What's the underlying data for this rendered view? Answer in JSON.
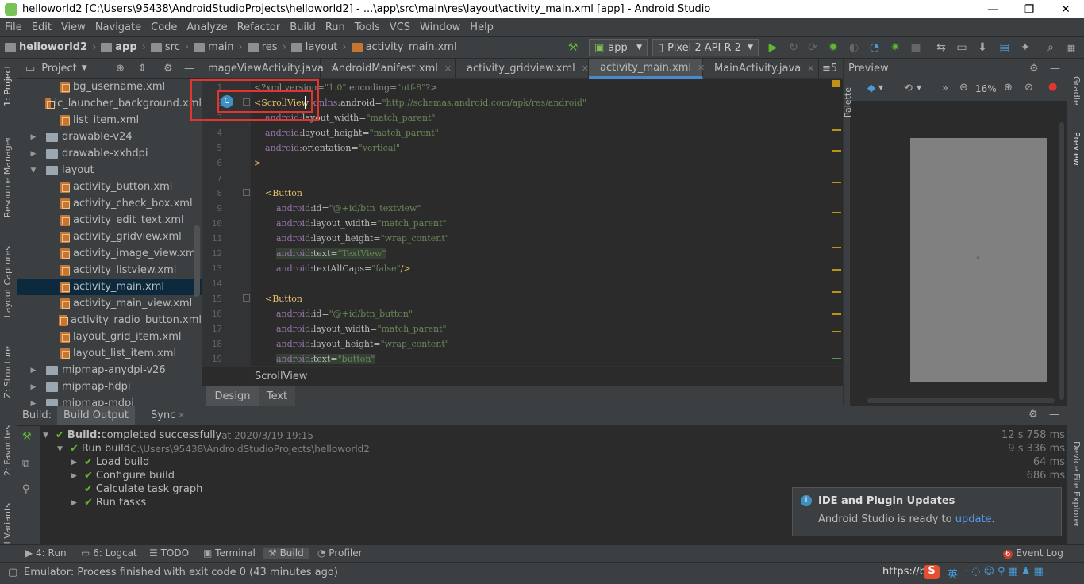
{
  "window": {
    "title": "helloworld2 [C:\\Users\\95438\\AndroidStudioProjects\\helloworld2] - ...\\app\\src\\main\\res\\layout\\activity_main.xml [app] - Android Studio",
    "min": "—",
    "max": "❐",
    "close": "✕"
  },
  "menu": [
    "File",
    "Edit",
    "View",
    "Navigate",
    "Code",
    "Analyze",
    "Refactor",
    "Build",
    "Run",
    "Tools",
    "VCS",
    "Window",
    "Help"
  ],
  "breadcrumbs": [
    "helloworld2",
    "app",
    "src",
    "main",
    "res",
    "layout",
    "activity_main.xml"
  ],
  "toolbar": {
    "config": "app",
    "device": "Pixel 2 API R 2"
  },
  "project": {
    "header": "Project",
    "items": [
      {
        "label": "bg_username.xml",
        "kind": "xml",
        "indent": 2
      },
      {
        "label": "ic_launcher_background.xml",
        "kind": "xml",
        "indent": 2
      },
      {
        "label": "list_item.xml",
        "kind": "xml",
        "indent": 2
      },
      {
        "label": "drawable-v24",
        "kind": "folder",
        "indent": 1,
        "arrow": "▶"
      },
      {
        "label": "drawable-xxhdpi",
        "kind": "folder",
        "indent": 1,
        "arrow": "▶"
      },
      {
        "label": "layout",
        "kind": "folder",
        "indent": 1,
        "arrow": "▼"
      },
      {
        "label": "activity_button.xml",
        "kind": "xml",
        "indent": 2
      },
      {
        "label": "activity_check_box.xml",
        "kind": "xml",
        "indent": 2
      },
      {
        "label": "activity_edit_text.xml",
        "kind": "xml",
        "indent": 2
      },
      {
        "label": "activity_gridview.xml",
        "kind": "xml",
        "indent": 2
      },
      {
        "label": "activity_image_view.xml",
        "kind": "xml",
        "indent": 2
      },
      {
        "label": "activity_listview.xml",
        "kind": "xml",
        "indent": 2
      },
      {
        "label": "activity_main.xml",
        "kind": "xml",
        "indent": 2,
        "selected": true
      },
      {
        "label": "activity_main_view.xml",
        "kind": "xml",
        "indent": 2
      },
      {
        "label": "activity_radio_button.xml",
        "kind": "xml",
        "indent": 2
      },
      {
        "label": "layout_grid_item.xml",
        "kind": "xml",
        "indent": 2
      },
      {
        "label": "layout_list_item.xml",
        "kind": "xml",
        "indent": 2
      },
      {
        "label": "mipmap-anydpi-v26",
        "kind": "folder",
        "indent": 1,
        "arrow": "▶"
      },
      {
        "label": "mipmap-hdpi",
        "kind": "folder",
        "indent": 1,
        "arrow": "▶"
      },
      {
        "label": "mipmap-mdpi",
        "kind": "folder",
        "indent": 1,
        "arrow": "▶"
      }
    ]
  },
  "tabs": [
    {
      "label": "mageViewActivity.java",
      "type": "java"
    },
    {
      "label": "AndroidManifest.xml",
      "type": "manifest"
    },
    {
      "label": "activity_gridview.xml",
      "type": "xml"
    },
    {
      "label": "activity_main.xml",
      "type": "xml",
      "active": true
    },
    {
      "label": "MainActivity.java",
      "type": "class"
    }
  ],
  "tab_overflow": "≡5",
  "code_lines": [
    {
      "n": "1",
      "html": "<span class='dim'>&lt;?xml version=</span><span class='val'>\"1.0\"</span><span class='dim'> encoding=</span><span class='val'>\"utf-8\"</span><span class='dim'>?&gt;</span>"
    },
    {
      "n": "2",
      "html": "<span class='tag'>&lt;ScrollView</span> <span class='ns'>xmlns</span><span class='attr'>:android=</span><span class='val'>\"http://schemas.android.com/apk/res/android\"</span>"
    },
    {
      "n": "3",
      "html": "    <span class='ns'>android</span><span class='attr'>:layout_width=</span><span class='val'>\"match_parent\"</span>"
    },
    {
      "n": "4",
      "html": "    <span class='ns'>android</span><span class='attr'>:layout_height=</span><span class='val'>\"match_parent\"</span>"
    },
    {
      "n": "5",
      "html": "    <span class='ns'>android</span><span class='attr'>:orientation=</span><span class='val'>\"vertical\"</span>"
    },
    {
      "n": "6",
      "html": "<span class='tag'>&gt;</span>"
    },
    {
      "n": "7",
      "html": ""
    },
    {
      "n": "8",
      "html": "    <span class='tag'>&lt;Button</span>"
    },
    {
      "n": "9",
      "html": "        <span class='ns'>android</span><span class='attr'>:id=</span><span class='val'>\"@+id/btn_textview\"</span>"
    },
    {
      "n": "10",
      "html": "        <span class='ns'>android</span><span class='attr'>:layout_width=</span><span class='val'>\"match_parent\"</span>"
    },
    {
      "n": "11",
      "html": "        <span class='ns'>android</span><span class='attr'>:layout_height=</span><span class='val'>\"wrap_content\"</span>"
    },
    {
      "n": "12",
      "html": "        <span class='hl'><span class='ns'>android</span><span class='attr'>:text=</span><span class='val'>\"TextView\"</span></span>"
    },
    {
      "n": "13",
      "html": "        <span class='ns'>android</span><span class='attr'>:textAllCaps=</span><span class='val'>\"false\"</span><span class='tag'>/&gt;</span>"
    },
    {
      "n": "14",
      "html": ""
    },
    {
      "n": "15",
      "html": "    <span class='tag'>&lt;Button</span>"
    },
    {
      "n": "16",
      "html": "        <span class='ns'>android</span><span class='attr'>:id=</span><span class='val'>\"@+id/btn_button\"</span>"
    },
    {
      "n": "17",
      "html": "        <span class='ns'>android</span><span class='attr'>:layout_width=</span><span class='val'>\"match_parent\"</span>"
    },
    {
      "n": "18",
      "html": "        <span class='ns'>android</span><span class='attr'>:layout_height=</span><span class='val'>\"wrap_content\"</span>"
    },
    {
      "n": "19",
      "html": "        <span class='hl'><span class='ns'>android</span><span class='attr'>:text=</span><span class='val'>\"button\"</span></span>"
    }
  ],
  "editor_crumb": "ScrollView",
  "design_tabs": [
    "Design",
    "Text"
  ],
  "preview": {
    "title": "Preview",
    "zoom": "16%"
  },
  "left_tabs": [
    "1: Project",
    "Resource Manager",
    "Layout Captures",
    "Z: Structure",
    "2: Favorites",
    "l Variants"
  ],
  "right_tabs": [
    "Gradle",
    "Preview",
    "Device File Explorer"
  ],
  "palette_label": "Palette",
  "build": {
    "tabs": [
      "Build:",
      "Build Output",
      "Sync"
    ],
    "rows": [
      {
        "arrow": "▼",
        "label": "Build:",
        "rest": " completed successfully",
        "dim": " at 2020/3/19 19:15",
        "time": "12 s 758 ms",
        "indent": 0,
        "bold": true
      },
      {
        "arrow": "▼",
        "label": "Run build",
        "rest": "",
        "dim": " C:\\Users\\95438\\AndroidStudioProjects\\helloworld2",
        "time": "9 s 336 ms",
        "indent": 1
      },
      {
        "arrow": "▶",
        "label": "Load build",
        "rest": "",
        "dim": "",
        "time": "64 ms",
        "indent": 2
      },
      {
        "arrow": "▶",
        "label": "Configure build",
        "rest": "",
        "dim": "",
        "time": "686 ms",
        "indent": 2
      },
      {
        "arrow": "",
        "label": "Calculate task graph",
        "rest": "",
        "dim": "",
        "time": "",
        "indent": 2
      },
      {
        "arrow": "▶",
        "label": "Run tasks",
        "rest": "",
        "dim": "",
        "time": "",
        "indent": 2
      }
    ]
  },
  "notification": {
    "title": "IDE and Plugin Updates",
    "body": "Android Studio is ready to ",
    "link": "update",
    "tail": "."
  },
  "tools": [
    "4: Run",
    "6: Logcat",
    "TODO",
    "Terminal",
    "Build",
    "Profiler"
  ],
  "event_log": {
    "count": "6",
    "label": "Event Log"
  },
  "status": "Emulator: Process finished with exit code 0 (43 minutes ago)",
  "watermark": "https://b",
  "ime": "英"
}
